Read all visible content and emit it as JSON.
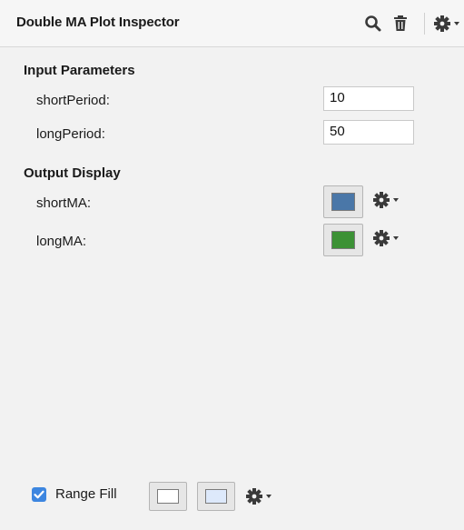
{
  "header": {
    "title": "Double MA Plot Inspector",
    "icons": [
      "search-icon",
      "trash-icon",
      "gear-icon",
      "chevron-down-icon"
    ]
  },
  "input_parameters": {
    "title": "Input Parameters",
    "short_period": {
      "label": "shortPeriod:",
      "value": "10"
    },
    "long_period": {
      "label": "longPeriod:",
      "value": "50"
    }
  },
  "output_display": {
    "title": "Output Display",
    "short_ma": {
      "label": "shortMA:",
      "color": "#4a77a8"
    },
    "long_ma": {
      "label": "longMA:",
      "color": "#3c9135"
    }
  },
  "range_fill": {
    "label": "Range Fill",
    "checked": true,
    "color_upper": "#ffffff",
    "color_lower": "#dde9fb"
  },
  "colors": {
    "checkbox_accent": "#3d86e0"
  }
}
